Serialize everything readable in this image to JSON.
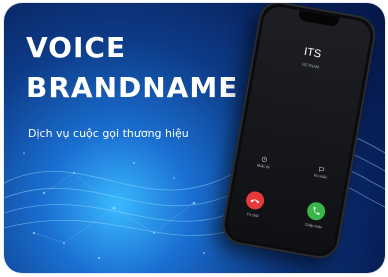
{
  "banner": {
    "title_line1": "VOICE",
    "title_line2": "BRANDNAME",
    "tagline": "Dịch vụ cuộc gọi thương hiệu"
  },
  "phone": {
    "caller_name": "ITS",
    "caller_sub": "VIETNAM",
    "option_left": "Nhắc tôi",
    "option_right": "Tin nhắn",
    "decline_label": "Từ chối",
    "accept_label": "Chấp nhận"
  },
  "colors": {
    "decline": "#e5393a",
    "accept": "#39b54a",
    "background_dark": "#08205a",
    "background_glow": "#3ab9ff"
  },
  "icons": [
    "alarm-icon",
    "message-icon",
    "phone-decline-icon",
    "phone-accept-icon"
  ]
}
